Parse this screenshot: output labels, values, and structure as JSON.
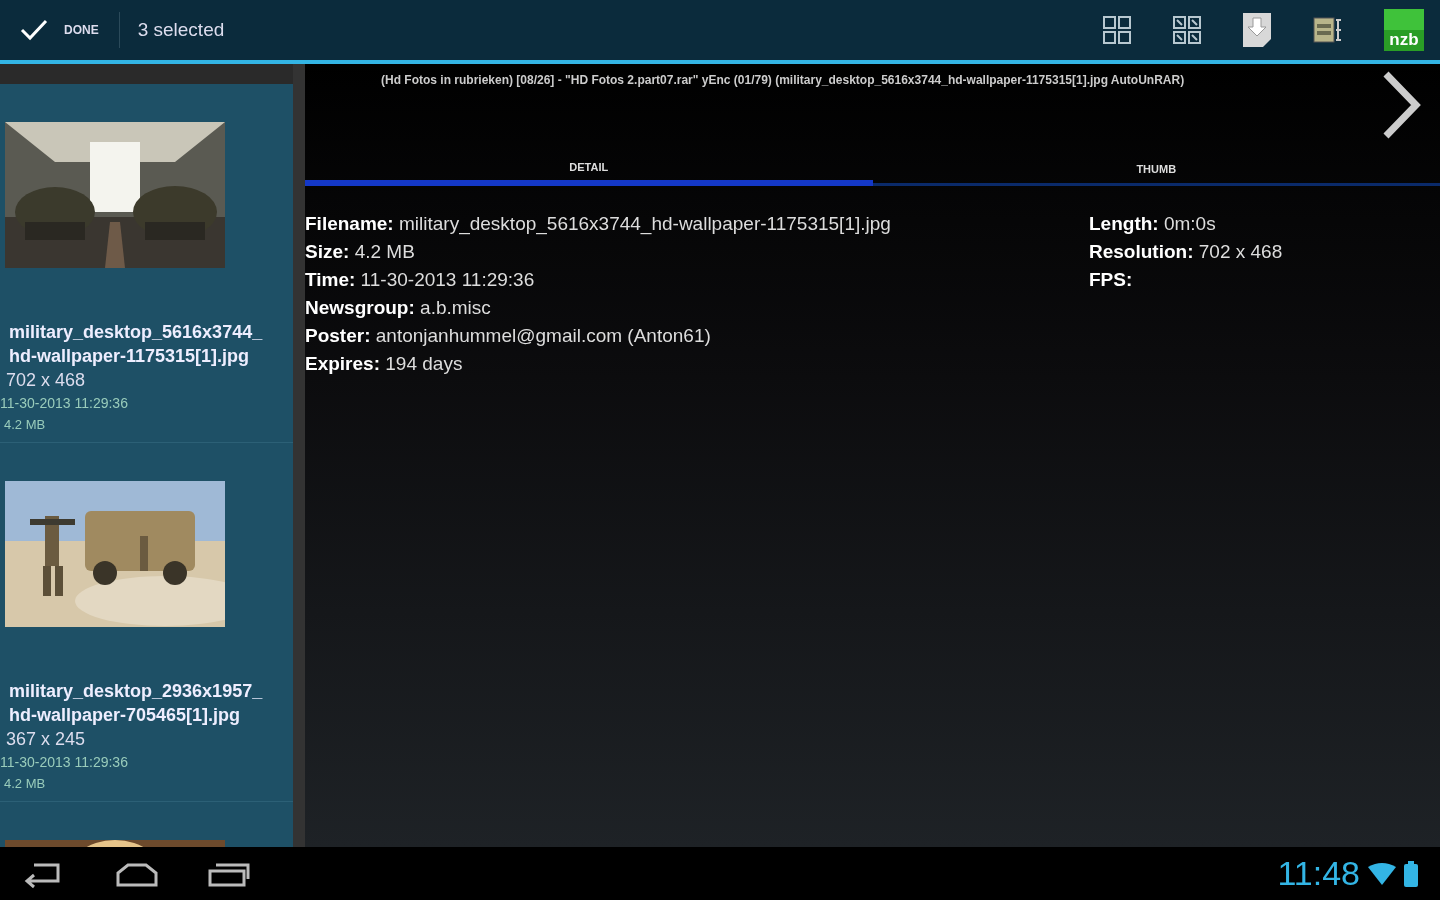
{
  "action_bar": {
    "done_label": "DONE",
    "selection_count": "3 selected",
    "actions": [
      {
        "kind": "grid"
      },
      {
        "kind": "grid-small"
      },
      {
        "kind": "download"
      },
      {
        "kind": "server"
      },
      {
        "kind": "nzb"
      }
    ],
    "nzb_label": "nzb"
  },
  "file_list": {
    "items": [
      {
        "name": "military_desktop_5616x3744_ hd-wallpaper-1175315[1].jpg",
        "resolution": "702 x 468",
        "time": "11-30-2013 11:29:36",
        "size": "4.2 MB",
        "kind": "picture"
      },
      {
        "name": "military_desktop_2936x1957_ hd-wallpaper-705465[1].jpg",
        "resolution": "367 x 245",
        "time": "11-30-2013 11:29:36",
        "size": "4.2 MB",
        "kind": "picture"
      },
      {
        "kind": "picture"
      }
    ]
  },
  "detail": {
    "subject": "(Hd Fotos in rubrieken) [08/26] - \"HD Fotos 2.part07.rar\" yEnc (01/79) (military_desktop_5616x3744_hd-wallpaper-1175315[1].jpg AutoUnRAR)",
    "tabs": [
      {
        "label": "DETAIL",
        "selected": true
      },
      {
        "label": "THUMB",
        "selected": false
      }
    ],
    "left_fields": [
      {
        "label": "Filename:",
        "value": "military_desktop_5616x3744_hd-wallpaper-1175315[1].jpg"
      },
      {
        "label": "Size:",
        "value": "4.2 MB"
      },
      {
        "label": "Time:",
        "value": "11-30-2013 11:29:36"
      },
      {
        "label": "Newsgroup:",
        "value": "a.b.misc"
      },
      {
        "label": "Poster:",
        "value": "antonjanhummel@gmail.com (Anton61)"
      },
      {
        "label": "Expires:",
        "value": "194 days"
      }
    ],
    "right_fields": [
      {
        "label": "Length:",
        "value": "0m:0s"
      },
      {
        "label": "Resolution:",
        "value": "702 x 468"
      },
      {
        "label": "FPS:"
      }
    ]
  },
  "nav_bar": {
    "clock": "11:48"
  }
}
